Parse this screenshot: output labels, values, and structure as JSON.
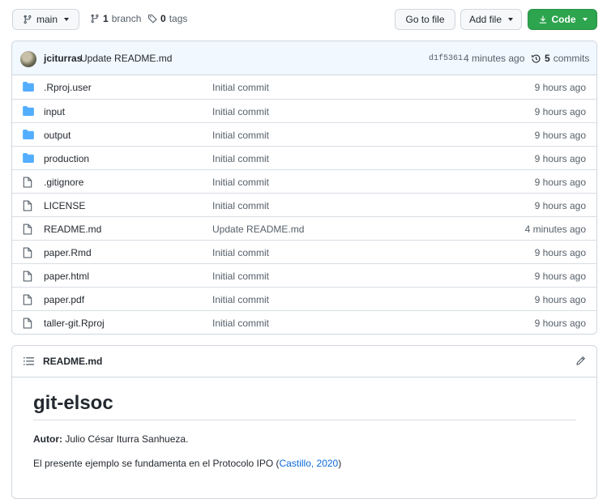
{
  "toolbar": {
    "branch_label": "main",
    "branches_count": "1",
    "branches_label": "branch",
    "tags_count": "0",
    "tags_label": "tags",
    "goto_file_label": "Go to file",
    "add_file_label": "Add file",
    "code_label": "Code"
  },
  "commit": {
    "author": "jciturras",
    "message": "Update README.md",
    "sha": "d1f5361",
    "when": "4 minutes ago",
    "commits_count": "5",
    "commits_label": "commits"
  },
  "files": [
    {
      "name": ".Rproj.user",
      "type": "folder",
      "message": "Initial commit",
      "age": "9 hours ago"
    },
    {
      "name": "input",
      "type": "folder",
      "message": "Initial commit",
      "age": "9 hours ago"
    },
    {
      "name": "output",
      "type": "folder",
      "message": "Initial commit",
      "age": "9 hours ago"
    },
    {
      "name": "production",
      "type": "folder",
      "message": "Initial commit",
      "age": "9 hours ago"
    },
    {
      "name": ".gitignore",
      "type": "file",
      "message": "Initial commit",
      "age": "9 hours ago"
    },
    {
      "name": "LICENSE",
      "type": "file",
      "message": "Initial commit",
      "age": "9 hours ago"
    },
    {
      "name": "README.md",
      "type": "file",
      "message": "Update README.md",
      "age": "4 minutes ago"
    },
    {
      "name": "paper.Rmd",
      "type": "file",
      "message": "Initial commit",
      "age": "9 hours ago"
    },
    {
      "name": "paper.html",
      "type": "file",
      "message": "Initial commit",
      "age": "9 hours ago"
    },
    {
      "name": "paper.pdf",
      "type": "file",
      "message": "Initial commit",
      "age": "9 hours ago"
    },
    {
      "name": "taller-git.Rproj",
      "type": "file",
      "message": "Initial commit",
      "age": "9 hours ago"
    }
  ],
  "readme": {
    "header_title": "README.md",
    "h1": "git-elsoc",
    "author_label": "Autor:",
    "author_value": " Julio César Iturra Sanhueza.",
    "intro_text": "El presente ejemplo se fundamenta en el Protocolo IPO (",
    "intro_link": "Castillo, 2020",
    "intro_close": ")"
  },
  "colors": {
    "accent_green": "#2da44e",
    "folder_blue": "#54aeff",
    "link_blue": "#0969da",
    "commit_bar_bg": "#f1f8ff"
  }
}
